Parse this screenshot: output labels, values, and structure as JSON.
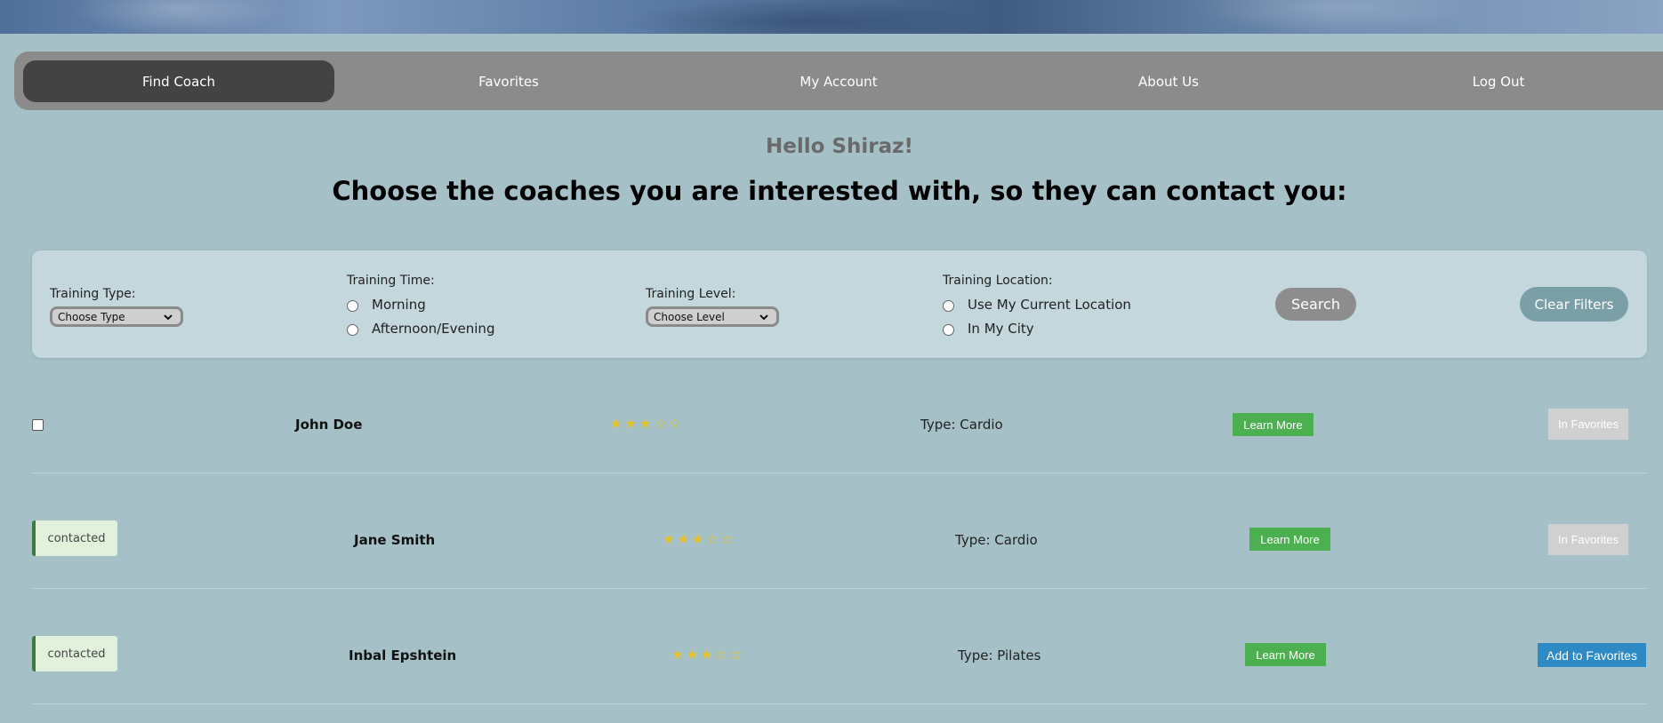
{
  "nav": {
    "items": [
      {
        "label": "Find Coach"
      },
      {
        "label": "Favorites"
      },
      {
        "label": "My Account"
      },
      {
        "label": "About Us"
      },
      {
        "label": "Log Out"
      }
    ]
  },
  "greeting": "Hello Shiraz!",
  "subtitle": "Choose the coaches you are interested with, so they can contact you:",
  "filters": {
    "training_type": {
      "label": "Training Type:",
      "value": "Choose Type"
    },
    "training_time": {
      "label": "Training Time:",
      "options": [
        "Morning",
        "Afternoon/Evening"
      ]
    },
    "training_level": {
      "label": "Training Level:",
      "value": "Choose Level"
    },
    "training_location": {
      "label": "Training Location:",
      "options": [
        "Use My Current Location",
        "In My City"
      ]
    },
    "search_label": "Search",
    "clear_label": "Clear Filters"
  },
  "coaches": [
    {
      "status": "",
      "name": "John Doe",
      "stars": "★★★☆☆",
      "rating": 3,
      "type": "Type: Cardio",
      "learn_label": "Learn More",
      "fav_label": "In Favorites"
    },
    {
      "status": "contacted",
      "name": "Jane Smith",
      "stars": "★★★☆☆",
      "rating": 3,
      "type": "Type: Cardio",
      "learn_label": "Learn More",
      "fav_label": "In Favorites"
    },
    {
      "status": "contacted",
      "name": "Inbal Epshtein",
      "stars": "★★★☆☆",
      "rating": 3,
      "type": "Type: Pilates",
      "learn_label": "Learn More",
      "fav_label": "Add to Favorites"
    }
  ],
  "colors": {
    "background": "#a6c0c7",
    "nav": "#8b8b8b",
    "nav_active": "#434343",
    "learn": "#4caf50",
    "add_fav": "#2e8ac4",
    "in_fav": "#d0d0d0",
    "star": "#e8c323"
  }
}
